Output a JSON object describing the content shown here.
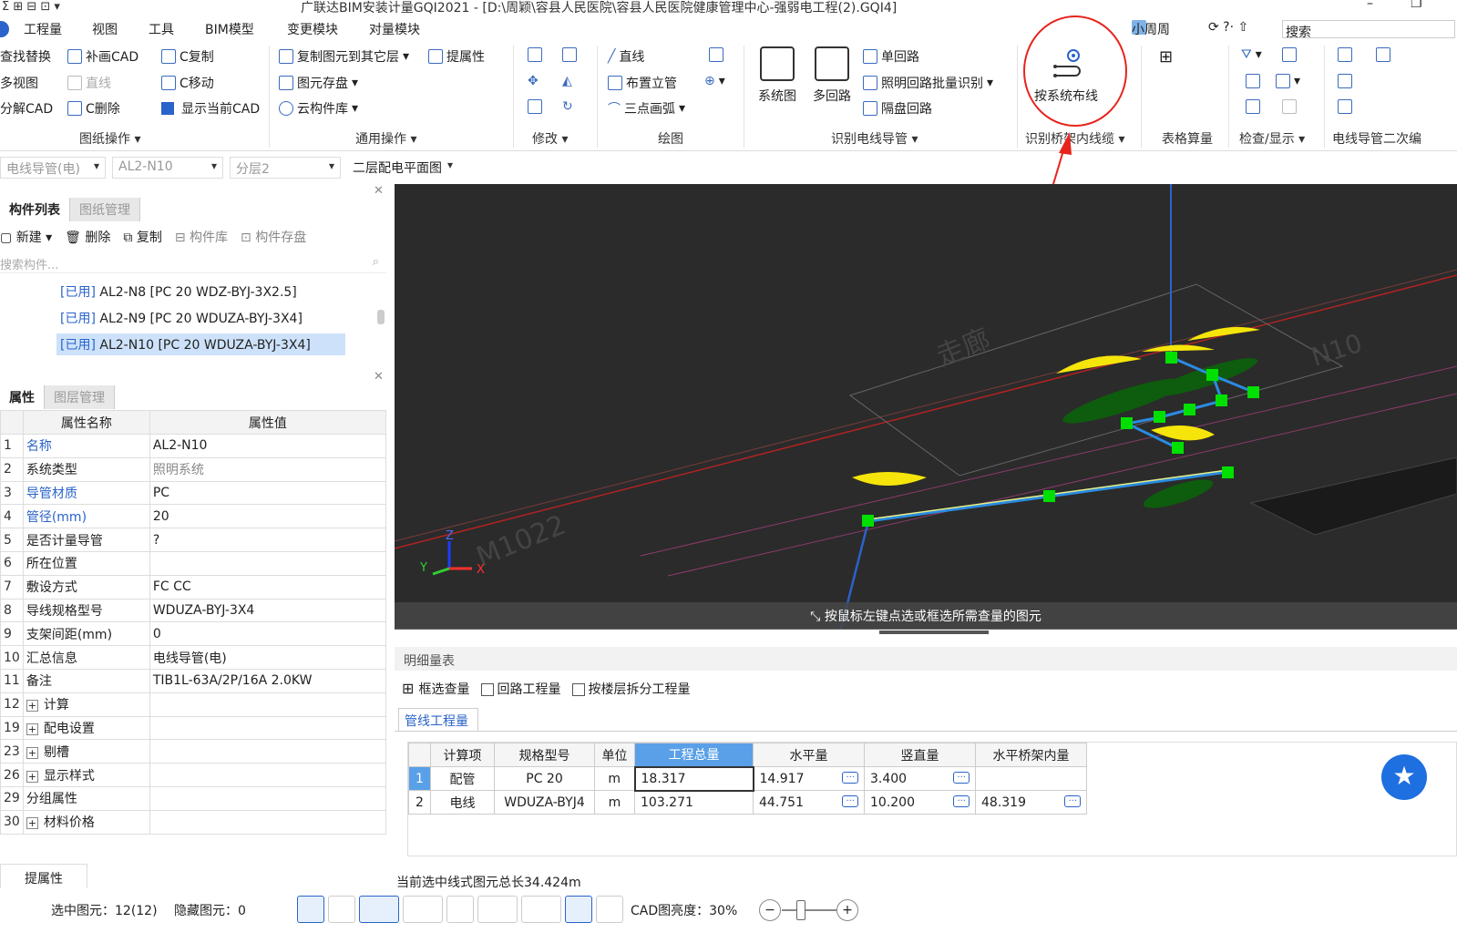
{
  "window": {
    "title": "广联达BIM安装计量GQI2021 - [D:\\周颖\\容县人民医院\\容县人民医院健康管理中心-强弱电工程(2).GQI4]"
  },
  "menu": [
    "工程量",
    "视图",
    "工具",
    "BIM模型",
    "变更模块",
    "对量模块"
  ],
  "user": {
    "name": "小周周",
    "search_placeholder": "搜索"
  },
  "ribbon": {
    "drawing_ops": {
      "items": [
        "查找替换",
        "补画CAD",
        "C复制",
        "多视图",
        "直线",
        "C移动",
        "分解CAD",
        "C删除",
        "显示当前CAD"
      ],
      "group": "图纸操作"
    },
    "common_ops": {
      "items": [
        "复制图元到其它层",
        "提属性",
        "图元存盘",
        "云构件库"
      ],
      "group": "通用操作"
    },
    "modify": {
      "group": "修改"
    },
    "draw": {
      "items": [
        "直线",
        "布置立管",
        "三点画弧"
      ],
      "group": "绘图"
    },
    "identify": {
      "items": [
        "系统图",
        "多回路",
        "单回路",
        "照明回路批量识别",
        "隔盘回路"
      ],
      "group": "识别电线导管"
    },
    "tray": {
      "items": [
        "按系统布线"
      ],
      "group": "识别桥架内线缆"
    },
    "table": {
      "group": "表格算量"
    },
    "check": {
      "group": "检查/显示"
    },
    "second": {
      "group": "电线导管二次编"
    }
  },
  "selectors": [
    "电线导管(电)",
    "AL2-N10",
    "分层2",
    "二层配电平面图"
  ],
  "left_panel": {
    "tabs": [
      "构件列表",
      "图纸管理"
    ],
    "toolbar": [
      "新建",
      "删除",
      "复制",
      "构件库",
      "构件存盘"
    ],
    "search_placeholder": "搜索构件...",
    "components": [
      {
        "tag": "[已用]",
        "name": "AL2-N8 [PC 20 WDZ-BYJ-3X2.5]"
      },
      {
        "tag": "[已用]",
        "name": "AL2-N9 [PC 20 WDUZA-BYJ-3X4]"
      },
      {
        "tag": "[已用]",
        "name": "AL2-N10 [PC 20 WDUZA-BYJ-3X4]"
      }
    ],
    "prop_tabs": [
      "属性",
      "图层管理"
    ],
    "prop_headers": [
      "属性名称",
      "属性值"
    ],
    "props": [
      {
        "n": "1",
        "name": "名称",
        "value": "AL2-N10"
      },
      {
        "n": "2",
        "name": "系统类型",
        "value": "照明系统"
      },
      {
        "n": "3",
        "name": "导管材质",
        "value": "PC"
      },
      {
        "n": "4",
        "name": "管径(mm)",
        "value": "20"
      },
      {
        "n": "5",
        "name": "是否计量导管",
        "value": "?"
      },
      {
        "n": "6",
        "name": "所在位置",
        "value": ""
      },
      {
        "n": "7",
        "name": "敷设方式",
        "value": "FC CC"
      },
      {
        "n": "8",
        "name": "导线规格型号",
        "value": "WDUZA-BYJ-3X4"
      },
      {
        "n": "9",
        "name": "支架间距(mm)",
        "value": "0"
      },
      {
        "n": "10",
        "name": "汇总信息",
        "value": "电线导管(电)"
      },
      {
        "n": "11",
        "name": "备注",
        "value": "TIB1L-63A/2P/16A 2.0KW"
      },
      {
        "n": "12",
        "name": "计算",
        "value": ""
      },
      {
        "n": "19",
        "name": "配电设置",
        "value": ""
      },
      {
        "n": "23",
        "name": "剔槽",
        "value": ""
      },
      {
        "n": "26",
        "name": "显示样式",
        "value": ""
      },
      {
        "n": "29",
        "name": "分组属性",
        "value": ""
      },
      {
        "n": "30",
        "name": "材料价格",
        "value": ""
      }
    ],
    "extract_button": "提属性"
  },
  "viewport": {
    "hint": "按鼠标左键点选或框选所需查量的图元",
    "labels": [
      "M1022",
      "N10",
      "走廊"
    ]
  },
  "detail": {
    "title": "明细量表",
    "options": [
      "框选查量",
      "回路工程量",
      "按楼层拆分工程量"
    ],
    "tab": "管线工程量",
    "headers": [
      "计算项",
      "规格型号",
      "单位",
      "工程总量",
      "水平量",
      "竖直量",
      "水平桥架内量"
    ],
    "rows": [
      {
        "n": "1",
        "item": "配管",
        "spec": "PC 20",
        "unit": "m",
        "total": "18.317",
        "horiz": "14.917",
        "vert": "3.400",
        "tray": ""
      },
      {
        "n": "2",
        "item": "电线",
        "spec": "WDUZA-BYJ4",
        "unit": "m",
        "total": "103.271",
        "horiz": "44.751",
        "vert": "10.200",
        "tray": "48.319"
      }
    ],
    "footer": "当前选中线式图元总长34.424m"
  },
  "status": {
    "selected": "选中图元：12(12)",
    "hidden": "隐藏图元：0",
    "brightness": "CAD图亮度：30%"
  },
  "colors": {
    "accent": "#2a63c9",
    "annotation": "#e8231d",
    "highlight": "#5aa0e8"
  }
}
